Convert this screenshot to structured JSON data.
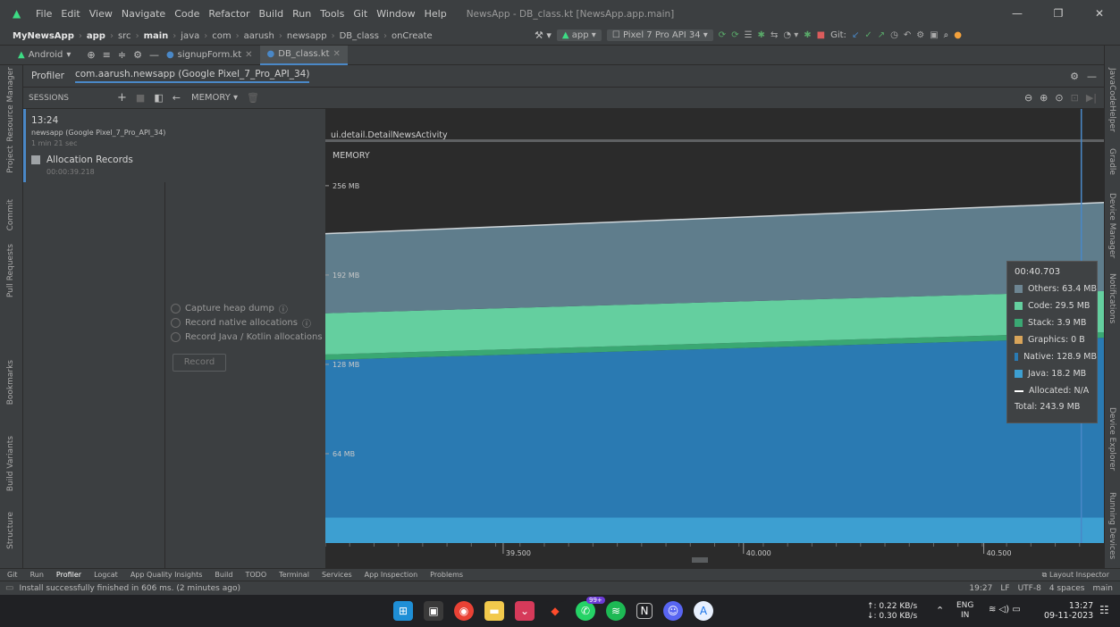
{
  "titlebar": {
    "menu": [
      "File",
      "Edit",
      "View",
      "Navigate",
      "Code",
      "Refactor",
      "Build",
      "Run",
      "Tools",
      "Git",
      "Window",
      "Help"
    ],
    "window_title": "NewsApp - DB_class.kt [NewsApp.app.main]"
  },
  "navbar": {
    "crumbs": [
      "MyNewsApp",
      "app",
      "src",
      "main",
      "java",
      "com",
      "aarush",
      "newsapp",
      "DB_class",
      "onCreate"
    ],
    "run_config": "app",
    "device": "Pixel 7 Pro API 34",
    "git_label": "Git:"
  },
  "tabs": {
    "project_view": "Android",
    "files": [
      "signupForm.kt",
      "DB_class.kt"
    ]
  },
  "left_tools": [
    "Resource Manager",
    "Project",
    "Commit",
    "Pull Requests",
    "Bookmarks",
    "Build Variants",
    "Structure"
  ],
  "right_tools": [
    "JavaCodeHelper",
    "Gradle",
    "Device Manager",
    "Notifications",
    "Device Explorer",
    "Running Devices"
  ],
  "profiler": {
    "title": "Profiler",
    "process": "com.aarush.newsapp (Google Pixel_7_Pro_API_34)",
    "sessions_label": "SESSIONS",
    "memory_dropdown": "MEMORY",
    "session": {
      "time": "13:24",
      "name": "newsapp (Google Pixel_7_Pro_API_34)",
      "duration": "1 min 21 sec",
      "record_title": "Allocation Records",
      "record_time": "00:00:39.218"
    },
    "options": [
      "Capture heap dump",
      "Record native allocations",
      "Record Java / Kotlin allocations"
    ],
    "record_button": "Record"
  },
  "chart_data": {
    "type": "area",
    "activity_label": "ui.detail.DetailNewsActivity",
    "section_label": "MEMORY",
    "y_ticks": [
      "256 MB",
      "192 MB",
      "128 MB",
      "64 MB"
    ],
    "ylim": [
      0,
      270
    ],
    "x_ticks": [
      "39.500",
      "40.000",
      "40.500"
    ],
    "xlim": [
      39.13,
      40.75
    ],
    "cursor_x": 40.703,
    "series": [
      {
        "name": "Java",
        "color": "#3d9fd1",
        "x": [
          39.13,
          40.75
        ],
        "values": [
          18.2,
          18.2
        ]
      },
      {
        "name": "Native",
        "color": "#2a7ab2",
        "x": [
          39.13,
          40.75
        ],
        "values": [
          113,
          128.9
        ]
      },
      {
        "name": "Stack",
        "color": "#3aa873",
        "x": [
          39.13,
          40.75
        ],
        "values": [
          3.9,
          3.9
        ]
      },
      {
        "name": "Code",
        "color": "#64cf9f",
        "x": [
          39.13,
          40.75
        ],
        "values": [
          29.5,
          29.5
        ]
      },
      {
        "name": "Others",
        "color": "#5f7d8c",
        "x": [
          39.13,
          40.75
        ],
        "values": [
          57,
          63.4
        ]
      }
    ],
    "tooltip": {
      "time": "00:40.703",
      "rows": [
        {
          "label": "Others: 63.4 MB",
          "color": "#6d8592"
        },
        {
          "label": "Code: 29.5 MB",
          "color": "#64cf9f"
        },
        {
          "label": "Stack: 3.9 MB",
          "color": "#3aa873"
        },
        {
          "label": "Graphics: 0 B",
          "color": "#d8a45a"
        },
        {
          "label": "Native: 128.9 MB",
          "color": "#2a7ab2"
        },
        {
          "label": "Java: 18.2 MB",
          "color": "#3d9fd1"
        },
        {
          "label": "Allocated: N/A",
          "color": "#ffffff"
        }
      ],
      "total": "Total: 243.9 MB"
    }
  },
  "bottom_tools": [
    "Git",
    "Run",
    "Profiler",
    "Logcat",
    "App Quality Insights",
    "Build",
    "TODO",
    "Terminal",
    "Services",
    "App Inspection",
    "Problems"
  ],
  "layout_inspector": "Layout Inspector",
  "status": {
    "message": "Install successfully finished in 606 ms. (2 minutes ago)",
    "right": [
      "19:27",
      "LF",
      "UTF-8",
      "4 spaces",
      "main"
    ]
  },
  "taskbar": {
    "net_up": "↑: 0.22 KB/s",
    "net_down": "↓: 0.30 KB/s",
    "lang": "ENG",
    "region": "IN",
    "time": "13:27",
    "date": "09-11-2023",
    "whatsapp_badge": "99+"
  }
}
